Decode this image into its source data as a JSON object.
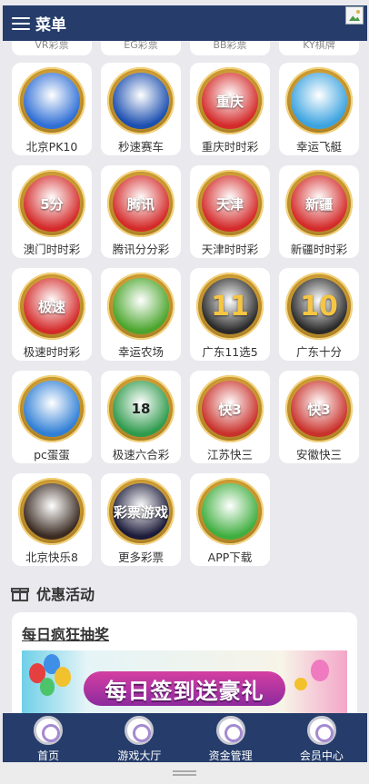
{
  "header": {
    "menu_label": "菜单",
    "avatar": "broken-image-icon"
  },
  "peek_row": [
    "VR彩票",
    "EG彩票",
    "BB彩票",
    "KY棋牌"
  ],
  "games": [
    {
      "label": "北京PK10",
      "icon": "race-car-icon",
      "color": "#2f6fd6"
    },
    {
      "label": "秒速赛车",
      "icon": "race-car-icon",
      "color": "#1b4fb0"
    },
    {
      "label": "重庆时时彩",
      "icon": "lottery-badge-icon",
      "color": "#d42a2a",
      "badge": "重庆"
    },
    {
      "label": "幸运飞艇",
      "icon": "speedboat-icon",
      "color": "#3ba3e0"
    },
    {
      "label": "澳门时时彩",
      "icon": "lottery-badge-icon",
      "color": "#d42a2a",
      "badge": "5分"
    },
    {
      "label": "腾讯分分彩",
      "icon": "lottery-badge-icon",
      "color": "#d42a2a",
      "badge": "腾讯"
    },
    {
      "label": "天津时时彩",
      "icon": "lottery-badge-icon",
      "color": "#d42a2a",
      "badge": "天津"
    },
    {
      "label": "新疆时时彩",
      "icon": "lottery-badge-icon",
      "color": "#d42a2a",
      "badge": "新疆"
    },
    {
      "label": "极速时时彩",
      "icon": "lottery-badge-icon",
      "color": "#d42a2a",
      "badge": "极速"
    },
    {
      "label": "幸运农场",
      "icon": "fruit-icon",
      "color": "#4aa52c"
    },
    {
      "label": "广东11选5",
      "icon": "number-11-icon",
      "color": "#2a2a2a",
      "badge": "11"
    },
    {
      "label": "广东十分",
      "icon": "number-10-icon",
      "color": "#2a2a2a",
      "badge": "10"
    },
    {
      "label": "pc蛋蛋",
      "icon": "golden-egg-icon",
      "color": "#2f7fd6"
    },
    {
      "label": "极速六合彩",
      "icon": "lottery-ball-icon",
      "color": "#2e9a4c",
      "badge": "18"
    },
    {
      "label": "江苏快三",
      "icon": "dice-icon",
      "color": "#c9312b",
      "badge": "快3"
    },
    {
      "label": "安徽快三",
      "icon": "dice-icon",
      "color": "#c9312b",
      "badge": "快3"
    },
    {
      "label": "北京快乐8",
      "icon": "billiard-balls-icon",
      "color": "#3a2a22"
    },
    {
      "label": "更多彩票",
      "icon": "lottery-tickets-icon",
      "color": "#1b1b3a",
      "badge": "彩票游戏"
    },
    {
      "label": "APP下载",
      "icon": "download-app-icon",
      "color": "#3fae3f"
    }
  ],
  "promotions": {
    "title": "优惠活动",
    "card_title": "每日疯狂抽奖",
    "banner_text": "每日签到送豪礼"
  },
  "tabbar": [
    {
      "label": "首页",
      "icon": "home-chip-icon"
    },
    {
      "label": "游戏大厅",
      "icon": "game-hall-icon"
    },
    {
      "label": "资金管理",
      "icon": "money-chip-icon"
    },
    {
      "label": "会员中心",
      "icon": "member-icon"
    }
  ]
}
